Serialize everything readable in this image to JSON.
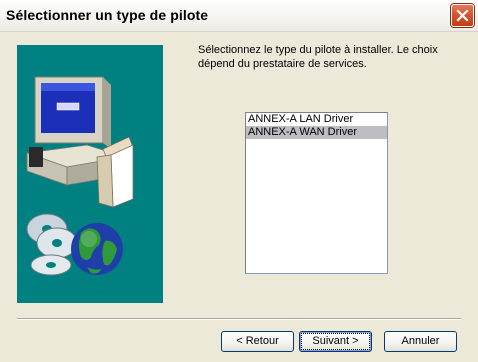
{
  "window": {
    "title": "Sélectionner un type de pilote"
  },
  "instruction": "Sélectionnez le type du pilote à installer. Le choix dépend du prestataire de services.",
  "driver_list": {
    "items": [
      {
        "label": "ANNEX-A LAN Driver",
        "selected": false
      },
      {
        "label": "ANNEX-A WAN Driver",
        "selected": true
      }
    ]
  },
  "buttons": {
    "back": "< Retour",
    "next": "Suivant >",
    "cancel": "Annuler"
  },
  "colors": {
    "banner_bg": "#008080",
    "selection_bg": "#bdbdc2",
    "dialog_bg": "#ece9d8"
  },
  "icons": {
    "close": "close-icon",
    "banner": "computer-cd-globe-illustration"
  }
}
